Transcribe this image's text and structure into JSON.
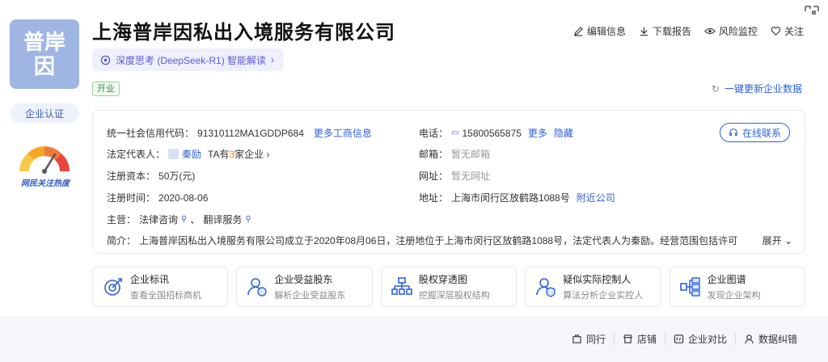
{
  "company": {
    "logo_text": [
      "普岸",
      "因"
    ],
    "name": "上海普岸因私出入境服务有限公司",
    "status": "开业",
    "certification_label": "企业认证",
    "heat_label": "网民关注热度"
  },
  "ai": {
    "label": "深度思考 (DeepSeek-R1) 智能解读"
  },
  "top_actions": [
    {
      "icon": "edit-icon",
      "label": "编辑信息"
    },
    {
      "icon": "download-icon",
      "label": "下载报告"
    },
    {
      "icon": "eye-icon",
      "label": "风险监控"
    },
    {
      "icon": "heart-icon",
      "label": "关注"
    }
  ],
  "update_label": "一键更新企业数据",
  "info": {
    "credit_code_label": "统一社会信用代码：",
    "credit_code": "91310112MA1GDDP684",
    "more_business_info": "更多工商信息",
    "legal_rep_label": "法定代表人：",
    "legal_rep_name": "秦励",
    "ta_has_prefix": "TA有",
    "ta_has_count": "3",
    "ta_has_suffix": "家企业",
    "capital_label": "注册资本：",
    "capital": "50万(元)",
    "reg_time_label": "注册时间：",
    "reg_time": "2020-08-06",
    "business_label": "主营：",
    "business_1": "法律咨询",
    "business_sep": "、",
    "business_2": "翻译服务",
    "intro_label": "简介：",
    "intro": "上海普岸因私出入境服务有限公司成立于2020年08月06日，注册地位于上海市闵行区放鹤路1088号，法定代表人为秦励。经营范围包括许可",
    "expand": "展开",
    "phone_label": "电话：",
    "phone": "15800565875",
    "phone_more": "更多",
    "phone_hide": "隐藏",
    "email_label": "邮箱：",
    "email": "暂无邮箱",
    "website_label": "网址：",
    "website": "暂无网址",
    "address_label": "地址：",
    "address": "上海市闵行区放鹤路1088号",
    "nearby": "附近公司",
    "contact_button": "在线联系"
  },
  "features": [
    {
      "icon": "target-icon",
      "title": "企业标讯",
      "subtitle": "查看全国招标商机"
    },
    {
      "icon": "beneficiary-icon",
      "title": "企业受益股东",
      "subtitle": "解析企业受益股东"
    },
    {
      "icon": "org-chart-icon",
      "title": "股权穿透图",
      "subtitle": "挖掘深层股权结构"
    },
    {
      "icon": "controller-icon",
      "title": "疑似实际控制人",
      "subtitle": "算法分析企业实控人"
    },
    {
      "icon": "graph-icon",
      "title": "企业图谱",
      "subtitle": "发现企业架构"
    }
  ],
  "footer_actions": [
    {
      "icon": "peer-icon",
      "label": "同行"
    },
    {
      "icon": "shop-icon",
      "label": "店铺"
    },
    {
      "icon": "compare-icon",
      "label": "企业对比"
    },
    {
      "icon": "correction-icon",
      "label": "数据纠错"
    }
  ],
  "colors": {
    "accent": "#2f62d9",
    "logo_bg": "#9fb6e4",
    "status_green": "#2f9a3f"
  }
}
